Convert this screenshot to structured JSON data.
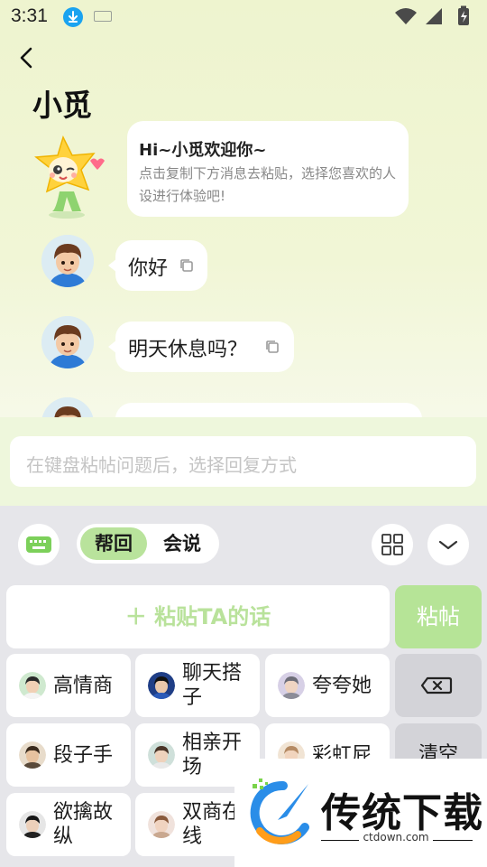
{
  "status_bar": {
    "time": "3:31"
  },
  "header": {
    "title": "小觅"
  },
  "welcome": {
    "title": "Hi~小觅欢迎你~",
    "description": "点击复制下方消息去粘贴，选择您喜欢的人设进行体验吧!"
  },
  "messages": [
    {
      "text": "你好"
    },
    {
      "text": "明天休息吗？"
    }
  ],
  "input": {
    "placeholder": "在键盘粘帖问题后，选择回复方式"
  },
  "toolbar": {
    "tabs": [
      {
        "label": "帮回",
        "active": true
      },
      {
        "label": "会说",
        "active": false
      }
    ]
  },
  "actions": {
    "paste_ta_label": "＋ 粘贴TA的话",
    "paste_label": "粘帖"
  },
  "styles": [
    {
      "label": "高情商"
    },
    {
      "label": "聊天搭子"
    },
    {
      "label": "夸夸她"
    },
    {
      "label": "段子手"
    },
    {
      "label": "相亲开场"
    },
    {
      "label": "彩虹屁"
    },
    {
      "label": "欲擒故纵"
    },
    {
      "label": "双商在线"
    }
  ],
  "keys": {
    "clear_label": "清空"
  },
  "watermark": {
    "title": "传统下载",
    "url": "ctdown.com"
  },
  "colors": {
    "accent": "#b6e497",
    "accent_text": "#b9e29b",
    "tab_active": "#b9e39c",
    "panel": "#e6e6ea"
  },
  "icons": {
    "back": "chevron-left-icon",
    "copy": "copy-icon",
    "keyboard": "keyboard-icon",
    "grid": "grid-icon",
    "collapse": "chevron-down-icon",
    "delete": "backspace-icon"
  }
}
